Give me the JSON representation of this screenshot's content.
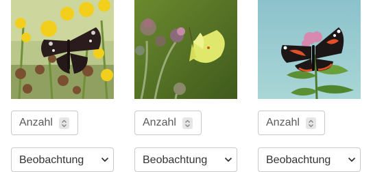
{
  "cards": [
    {
      "image_subject": "peacock butterfly on yellow flowers",
      "quantity": {
        "placeholder": "Anzahl",
        "value": ""
      },
      "observation": {
        "selected": "Beobachtung"
      }
    },
    {
      "image_subject": "brimstone butterfly on thistle",
      "quantity": {
        "placeholder": "Anzahl",
        "value": ""
      },
      "observation": {
        "selected": "Beobachtung"
      }
    },
    {
      "image_subject": "red admiral butterfly on pink flower",
      "quantity": {
        "placeholder": "Anzahl",
        "value": ""
      },
      "observation": {
        "selected": "Beobachtung"
      }
    }
  ],
  "colors": {
    "border": "#c9c9c9",
    "text": "#333333",
    "placeholder": "#5a5a5a",
    "spinner_bg": "#e6e6e6"
  }
}
